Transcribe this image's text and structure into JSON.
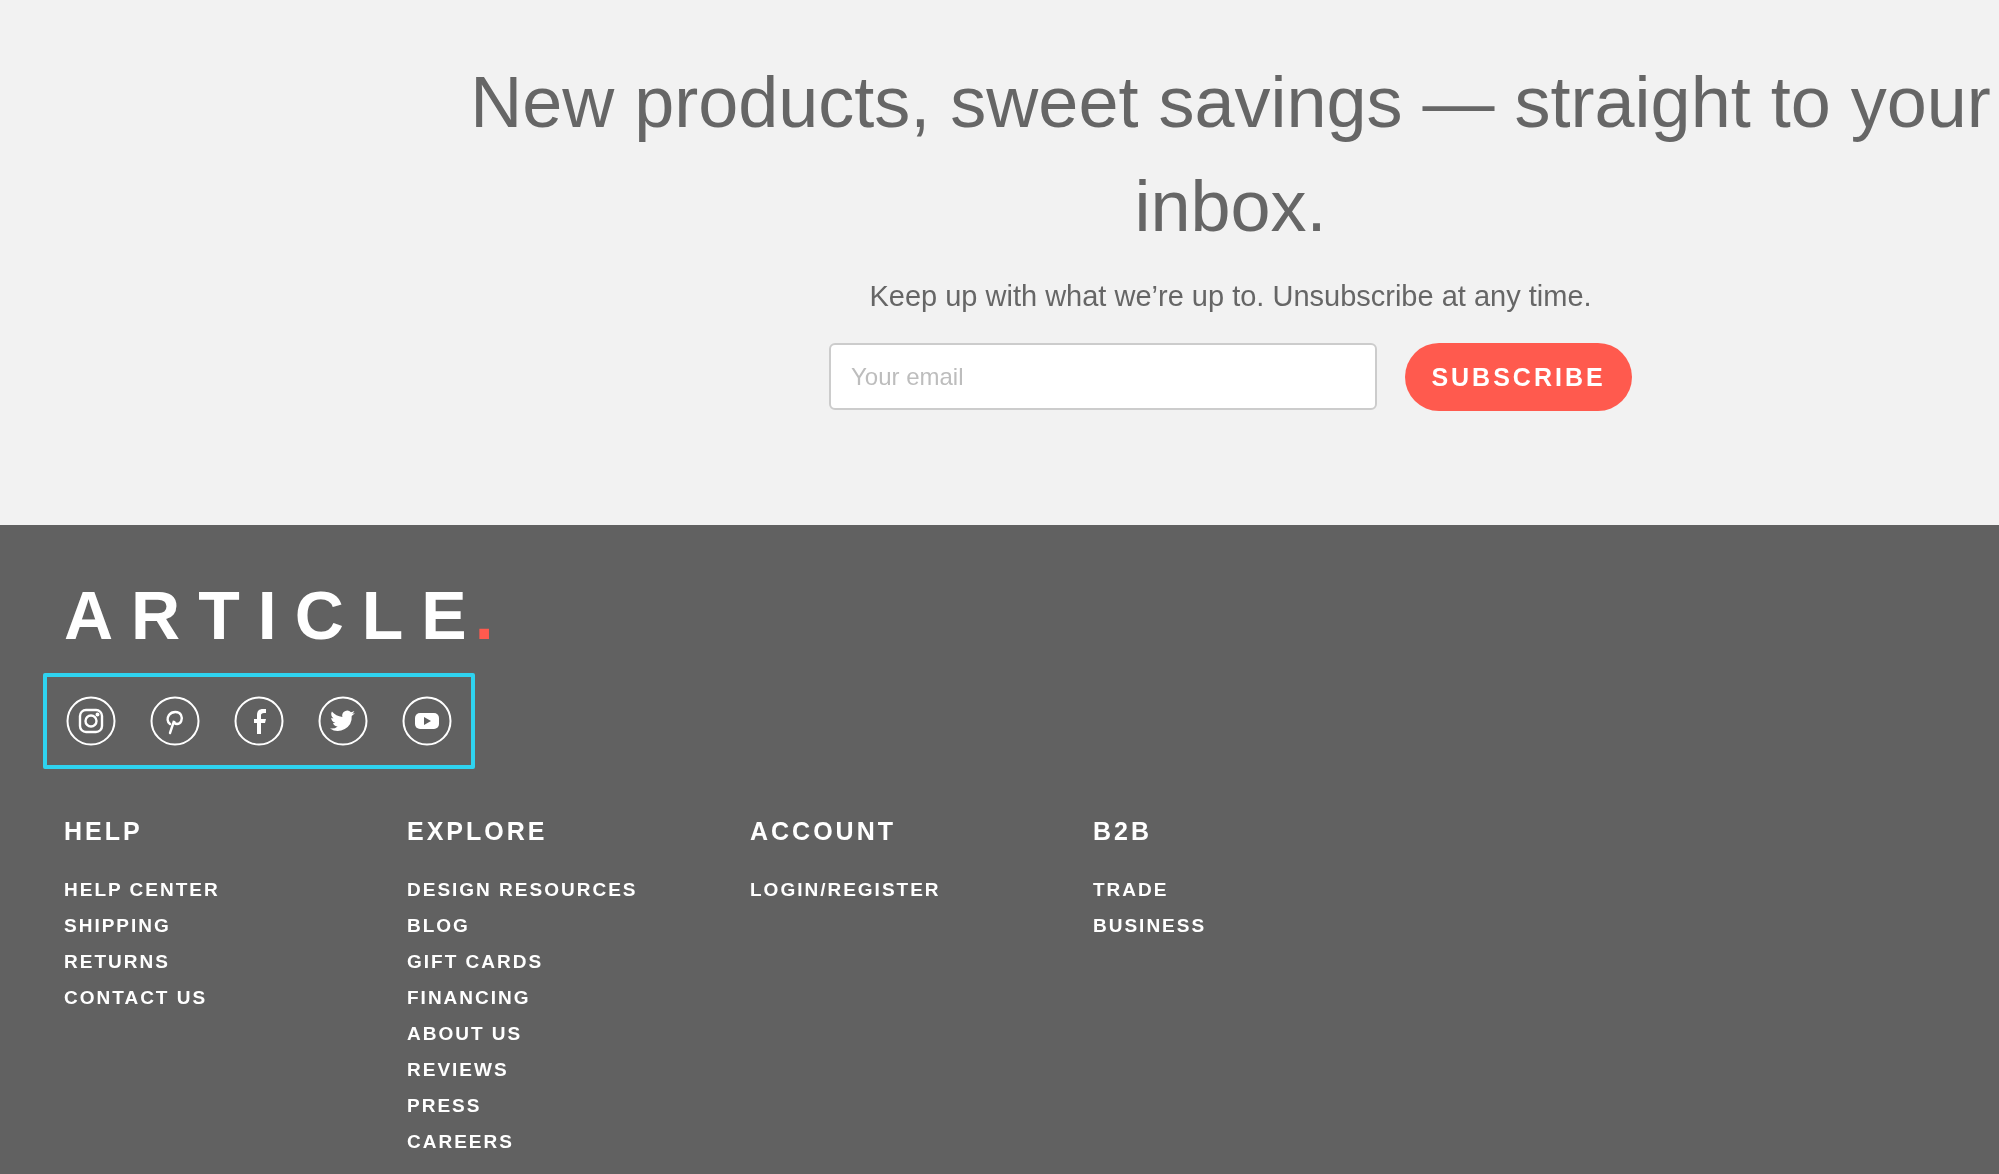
{
  "newsletter": {
    "heading": "New products, sweet savings — straight to your inbox.",
    "subtext": "Keep up with what we’re up to. Unsubscribe at any time.",
    "email": {
      "placeholder": "Your email"
    },
    "button": "SUBSCRIBE"
  },
  "footer": {
    "logo": {
      "text": "ARTICLE",
      "dot": "."
    },
    "social": {
      "highlighted": true,
      "icons": [
        {
          "kind": "instagram"
        },
        {
          "kind": "pinterest"
        },
        {
          "kind": "facebook"
        },
        {
          "kind": "twitter"
        },
        {
          "kind": "youtube"
        }
      ]
    },
    "columns": [
      {
        "heading": "HELP",
        "links": [
          "HELP CENTER",
          "SHIPPING",
          "RETURNS",
          "CONTACT US"
        ]
      },
      {
        "heading": "EXPLORE",
        "links": [
          "DESIGN RESOURCES",
          "BLOG",
          "GIFT CARDS",
          "FINANCING",
          "ABOUT US",
          "REVIEWS",
          "PRESS",
          "CAREERS"
        ]
      },
      {
        "heading": "ACCOUNT",
        "links": [
          "LOGIN/REGISTER"
        ]
      },
      {
        "heading": "B2B",
        "links": [
          "TRADE",
          "BUSINESS"
        ]
      }
    ]
  }
}
